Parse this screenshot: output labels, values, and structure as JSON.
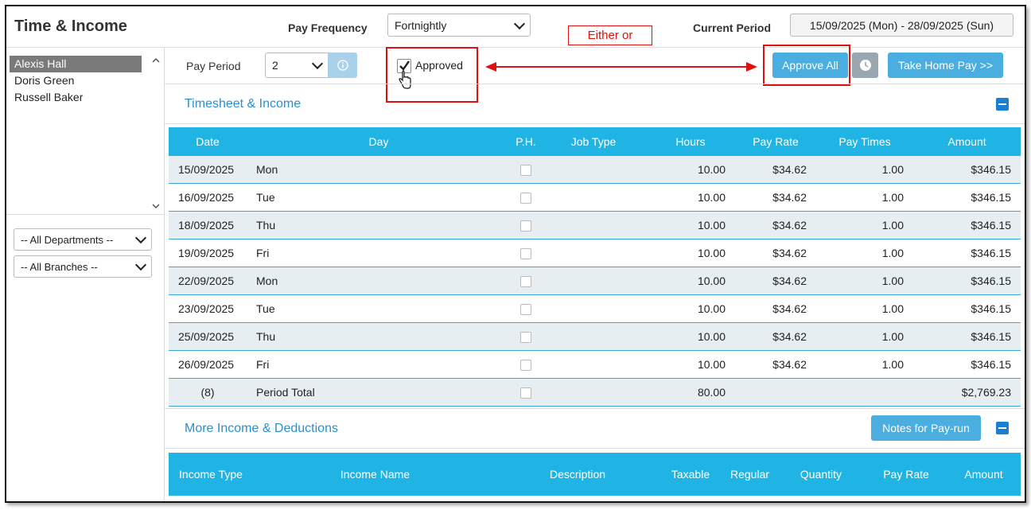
{
  "header": {
    "app_title": "Time & Income",
    "pay_frequency_label": "Pay Frequency",
    "pay_frequency_value": "Fortnightly",
    "current_period_label": "Current Period",
    "current_period_value": "15/09/2025 (Mon) - 28/09/2025 (Sun)"
  },
  "sidebar": {
    "employees": [
      {
        "name": "Alexis Hall",
        "selected": true
      },
      {
        "name": "Doris Green",
        "selected": false
      },
      {
        "name": "Russell Baker",
        "selected": false
      }
    ],
    "department_filter": "-- All Departments --",
    "branch_filter": "-- All Branches --"
  },
  "toolbar": {
    "pay_period_label": "Pay Period",
    "pay_period_value": "2",
    "approved_label": "Approved",
    "approved_checked": true,
    "approve_all_label": "Approve All",
    "take_home_pay_label": "Take Home Pay >>"
  },
  "annotation": {
    "either_or_text": "Either or",
    "color": "#e01010"
  },
  "timesheet": {
    "title": "Timesheet & Income",
    "columns": [
      "Date",
      "Day",
      "P.H.",
      "Job Type",
      "Hours",
      "Pay Rate",
      "Pay Times",
      "Amount"
    ],
    "rows": [
      {
        "date": "15/09/2025",
        "day": "Mon",
        "job_type": "",
        "hours": "10.00",
        "pay_rate": "$34.62",
        "pay_times": "1.00",
        "amount": "$346.15"
      },
      {
        "date": "16/09/2025",
        "day": "Tue",
        "job_type": "",
        "hours": "10.00",
        "pay_rate": "$34.62",
        "pay_times": "1.00",
        "amount": "$346.15"
      },
      {
        "date": "18/09/2025",
        "day": "Thu",
        "job_type": "",
        "hours": "10.00",
        "pay_rate": "$34.62",
        "pay_times": "1.00",
        "amount": "$346.15"
      },
      {
        "date": "19/09/2025",
        "day": "Fri",
        "job_type": "",
        "hours": "10.00",
        "pay_rate": "$34.62",
        "pay_times": "1.00",
        "amount": "$346.15"
      },
      {
        "date": "22/09/2025",
        "day": "Mon",
        "job_type": "",
        "hours": "10.00",
        "pay_rate": "$34.62",
        "pay_times": "1.00",
        "amount": "$346.15"
      },
      {
        "date": "23/09/2025",
        "day": "Tue",
        "job_type": "",
        "hours": "10.00",
        "pay_rate": "$34.62",
        "pay_times": "1.00",
        "amount": "$346.15"
      },
      {
        "date": "25/09/2025",
        "day": "Thu",
        "job_type": "",
        "hours": "10.00",
        "pay_rate": "$34.62",
        "pay_times": "1.00",
        "amount": "$346.15"
      },
      {
        "date": "26/09/2025",
        "day": "Fri",
        "job_type": "",
        "hours": "10.00",
        "pay_rate": "$34.62",
        "pay_times": "1.00",
        "amount": "$346.15"
      }
    ],
    "total": {
      "count": "(8)",
      "label": "Period Total",
      "hours": "80.00",
      "amount": "$2,769.23"
    }
  },
  "more_income": {
    "title": "More Income & Deductions",
    "notes_button_label": "Notes for Pay-run",
    "columns": [
      "Income Type",
      "Income Name",
      "Description",
      "Taxable",
      "Regular",
      "Quantity",
      "Pay Rate",
      "Amount"
    ]
  },
  "colors": {
    "table_header": "#1fb4e3",
    "button_blue": "#4aaee0",
    "link_blue": "#2b8fce"
  }
}
